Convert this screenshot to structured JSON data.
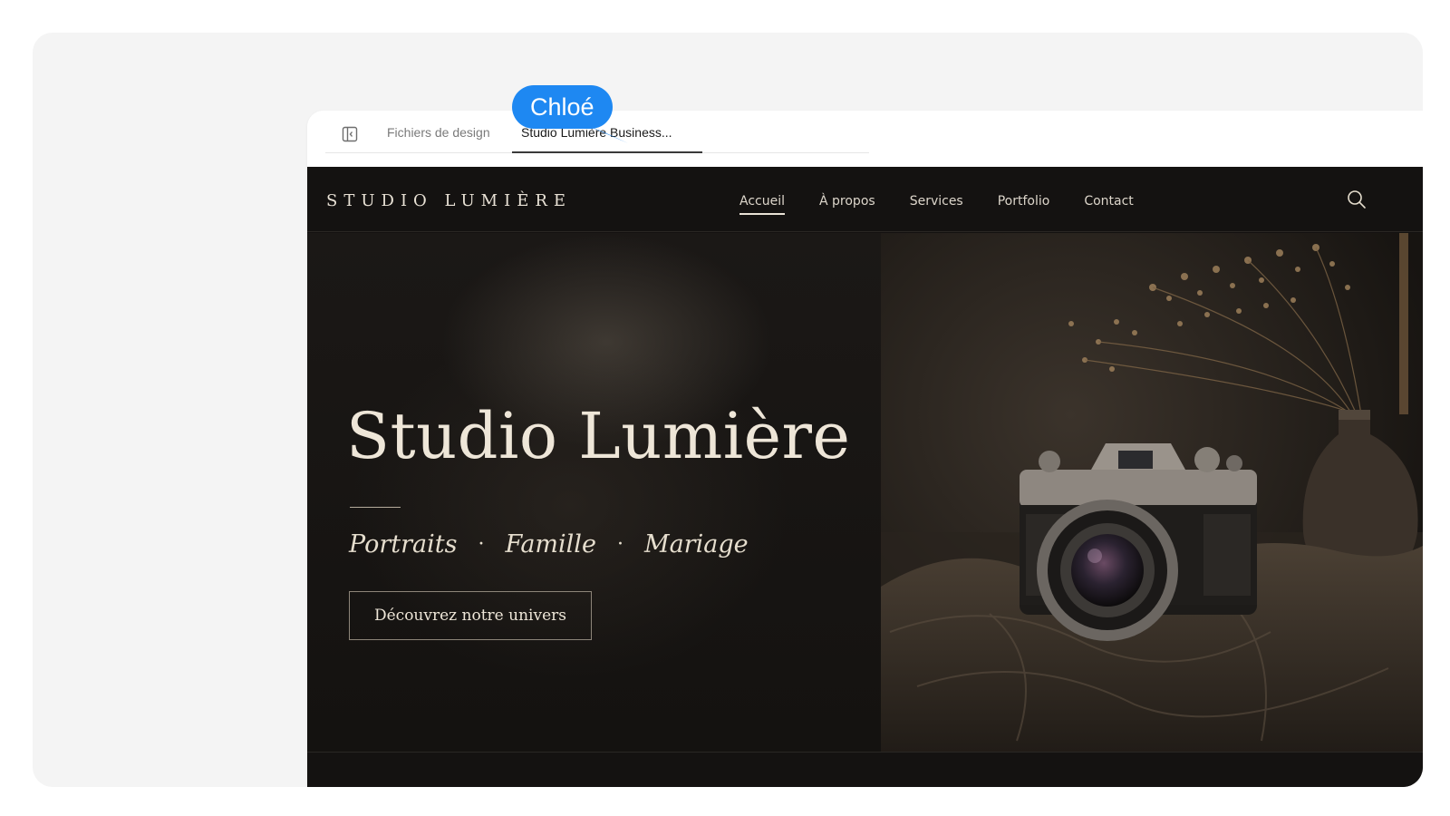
{
  "tabs": {
    "sidebar_icon": "sidebar-panel-icon",
    "files_label": "Fichiers de design",
    "active_label": "Studio Lumière Business..."
  },
  "site": {
    "brand": "STUDIO LUMIÈRE",
    "nav": {
      "items": [
        "Accueil",
        "À propos",
        "Services",
        "Portfolio",
        "Contact"
      ],
      "active": "Accueil"
    },
    "search_icon": "search-icon",
    "hero": {
      "title": "Studio Lumière",
      "tags": [
        "Portraits",
        "Famille",
        "Mariage"
      ],
      "separator": "·",
      "cta_label": "Découvrez notre univers",
      "image": "vintage-camera-on-fabric-with-dried-flowers"
    }
  },
  "collaborator": {
    "name": "Chloé",
    "color": "#1e88f2"
  },
  "colors": {
    "site_background": "#131110",
    "text_cream": "#eee6d8",
    "page_background": "#f4f4f4"
  }
}
